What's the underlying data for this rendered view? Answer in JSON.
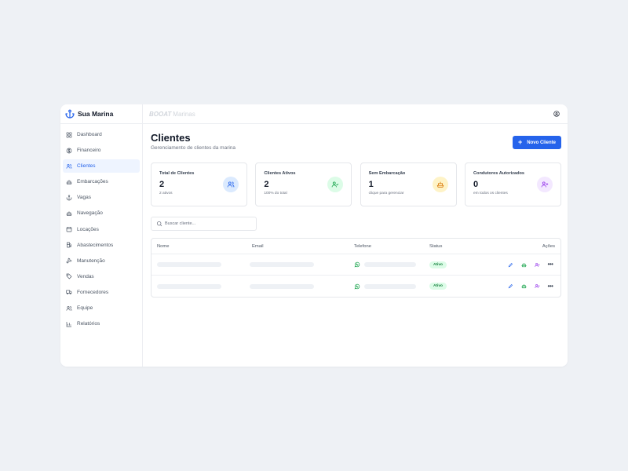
{
  "sidebar": {
    "brand": "Sua Marina",
    "items": [
      {
        "label": "Dashboard",
        "icon": "dashboard-icon"
      },
      {
        "label": "Financeiro",
        "icon": "dollar-icon"
      },
      {
        "label": "Clientes",
        "icon": "users-icon",
        "active": true
      },
      {
        "label": "Embarcações",
        "icon": "ship-icon"
      },
      {
        "label": "Vagas",
        "icon": "anchor-icon"
      },
      {
        "label": "Navegação",
        "icon": "ship-icon"
      },
      {
        "label": "Locações",
        "icon": "calendar-icon"
      },
      {
        "label": "Abastecimentos",
        "icon": "fuel-icon"
      },
      {
        "label": "Manutenção",
        "icon": "wrench-icon"
      },
      {
        "label": "Vendas",
        "icon": "tag-icon"
      },
      {
        "label": "Fornecedores",
        "icon": "truck-icon"
      },
      {
        "label": "Equipe",
        "icon": "users-icon"
      },
      {
        "label": "Relatórios",
        "icon": "chart-icon"
      }
    ]
  },
  "topbar": {
    "brand_bold": "BOOAT",
    "brand_rest": "Marinas",
    "user_icon": "user-circle-icon"
  },
  "page": {
    "title": "Clientes",
    "subtitle": "Gerenciamento de clientes da marina",
    "new_button": "Novo Cliente"
  },
  "stats": [
    {
      "title": "Total de Clientes",
      "value": "2",
      "note": "2 ativos",
      "icon": "users-icon",
      "color": "#2563eb",
      "bg": "#dbeafe"
    },
    {
      "title": "Clientes Ativos",
      "value": "2",
      "note": "100% do total",
      "icon": "user-check-icon",
      "color": "#16a34a",
      "bg": "#dcfce7"
    },
    {
      "title": "Sem Embarcação",
      "value": "1",
      "note": "clique para gerenciar",
      "icon": "ship-icon",
      "color": "#d97706",
      "bg": "#fef3c7"
    },
    {
      "title": "Condutores Autorizados",
      "value": "0",
      "note": "em todos os clientes",
      "icon": "user-plus-icon",
      "color": "#9333ea",
      "bg": "#f3e8ff"
    }
  ],
  "search": {
    "placeholder": "Buscar cliente...",
    "value": ""
  },
  "table": {
    "headers": {
      "name": "Nome",
      "email": "Email",
      "phone": "Telefone",
      "status": "Status",
      "actions": "Ações"
    },
    "rows": [
      {
        "status": "Ativo"
      },
      {
        "status": "Ativo"
      }
    ]
  },
  "colors": {
    "accent": "#2563eb",
    "active_bg": "#eef4ff",
    "success": "#16a34a"
  }
}
